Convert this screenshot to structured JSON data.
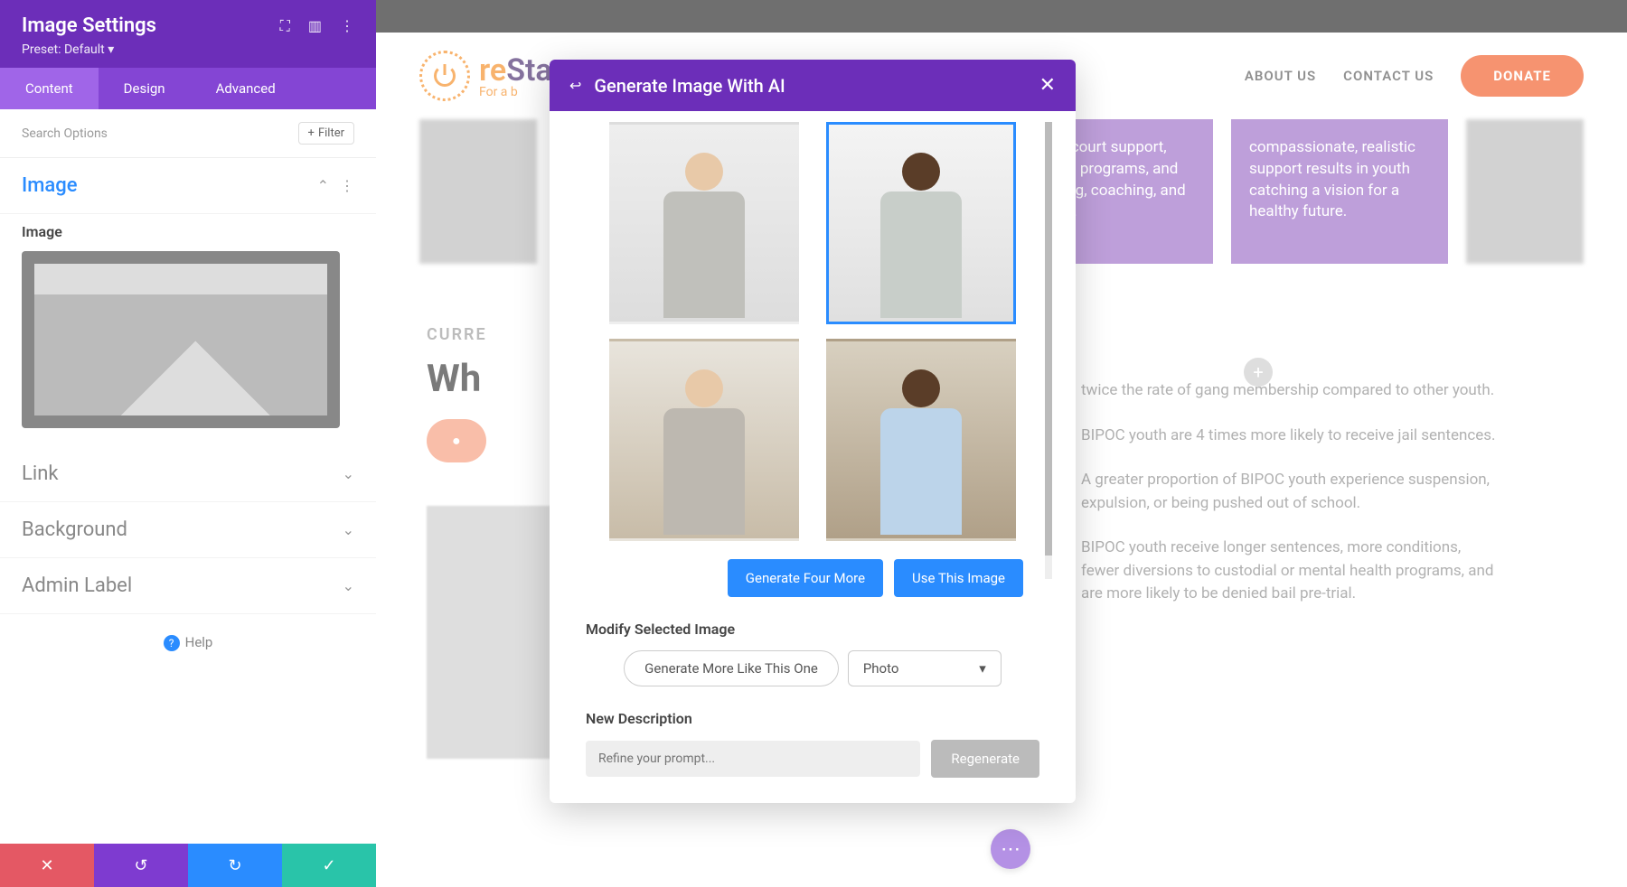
{
  "sidebar": {
    "title": "Image Settings",
    "preset": "Preset: Default ▾",
    "tabs": [
      "Content",
      "Design",
      "Advanced"
    ],
    "search_placeholder": "Search Options",
    "filter": "Filter",
    "sections": {
      "image": "Image",
      "image_field_label": "Image",
      "link": "Link",
      "background": "Background",
      "admin_label": "Admin Label"
    },
    "help": "Help"
  },
  "site": {
    "logo_main": "reStart",
    "logo_sub": "For a b",
    "nav": {
      "about": "ABOUT US",
      "contact": "CONTACT US"
    },
    "donate": "DONATE",
    "card1": "through court support, diversion programs, and mentoring, coaching, and teaching.",
    "card2": "compassionate, realistic support results in youth catching a vision for a healthy future.",
    "overline": "CURRE",
    "heading": "Wh",
    "facts": [
      "twice the rate of gang membership compared to other youth.",
      "BIPOC youth are 4 times more likely to receive jail sentences.",
      "A greater proportion of BIPOC youth experience suspension, expulsion, or being pushed out of school.",
      "BIPOC youth receive longer sentences, more conditions, fewer diversions to custodial or mental health programs, and are more likely to be denied bail pre-trial."
    ]
  },
  "modal": {
    "title": "Generate Image With AI",
    "generate_more": "Generate Four More",
    "use_image": "Use This Image",
    "modify_label": "Modify Selected Image",
    "like_this": "Generate More Like This One",
    "style_select": "Photo",
    "new_desc_label": "New Description",
    "refine_placeholder": "Refine your prompt...",
    "regenerate": "Regenerate"
  }
}
